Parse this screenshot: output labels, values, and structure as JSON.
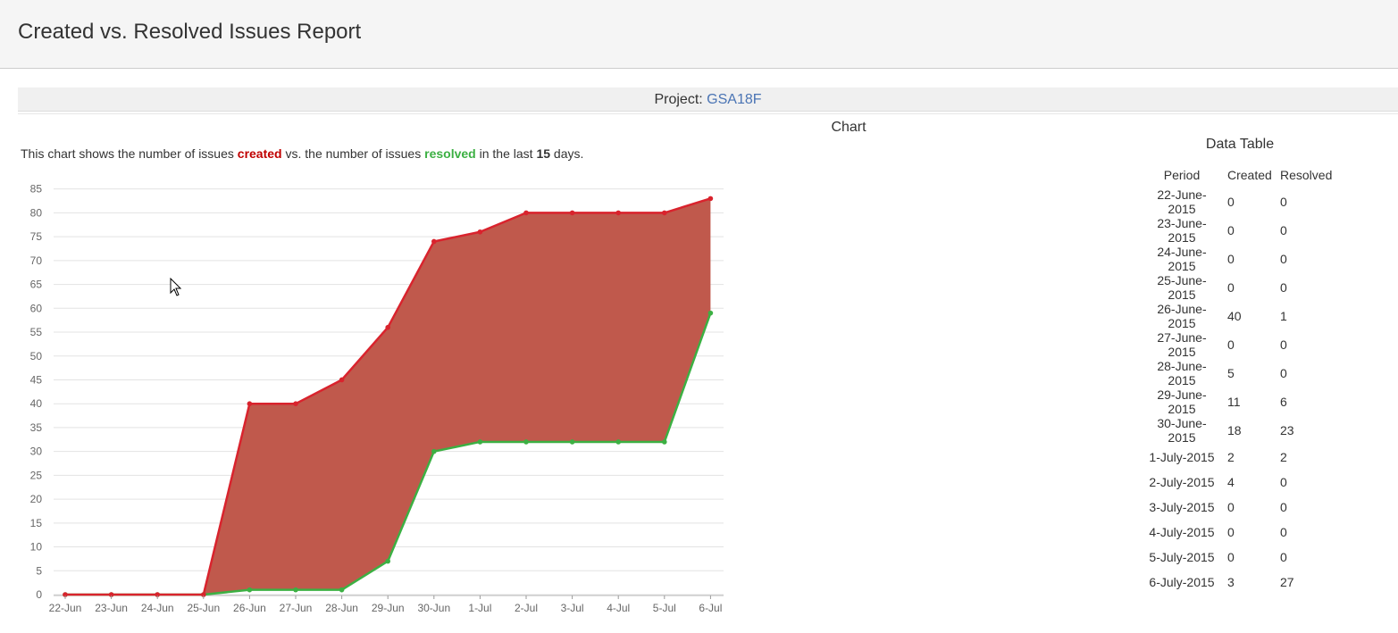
{
  "header": {
    "title": "Created vs. Resolved Issues Report"
  },
  "project": {
    "label": "Project:",
    "name": "GSA18F"
  },
  "chart_heading": "Chart",
  "description": {
    "prefix": "This chart shows the number of issues",
    "created_word": "created",
    "middle": "vs. the number of issues",
    "resolved_word": "resolved",
    "suffix_1": "in the last",
    "days": "15",
    "suffix_2": "days."
  },
  "colors": {
    "created": "#d9232d",
    "resolved": "#3cb043",
    "fill": "#c0594c",
    "link": "#4a74b4"
  },
  "chart_data": {
    "type": "area",
    "categories": [
      "22-Jun",
      "23-Jun",
      "24-Jun",
      "25-Jun",
      "26-Jun",
      "27-Jun",
      "28-Jun",
      "29-Jun",
      "30-Jun",
      "1-Jul",
      "2-Jul",
      "3-Jul",
      "4-Jul",
      "5-Jul",
      "6-Jul"
    ],
    "series": [
      {
        "values": [
          0,
          0,
          0,
          0,
          40,
          40,
          45,
          56,
          74,
          76,
          80,
          80,
          80,
          80,
          83
        ]
      },
      {
        "values": [
          0,
          0,
          0,
          0,
          1,
          1,
          1,
          7,
          30,
          32,
          32,
          32,
          32,
          32,
          59
        ]
      }
    ],
    "yticks": [
      0,
      5,
      10,
      15,
      20,
      25,
      30,
      35,
      40,
      45,
      50,
      55,
      60,
      65,
      70,
      75,
      80,
      85
    ],
    "ylim": [
      0,
      85
    ],
    "grid": true
  },
  "data_table": {
    "title": "Data Table",
    "headers": [
      "Period",
      "Created",
      "Resolved"
    ],
    "rows": [
      [
        "22-June-2015",
        "0",
        "0"
      ],
      [
        "23-June-2015",
        "0",
        "0"
      ],
      [
        "24-June-2015",
        "0",
        "0"
      ],
      [
        "25-June-2015",
        "0",
        "0"
      ],
      [
        "26-June-2015",
        "40",
        "1"
      ],
      [
        "27-June-2015",
        "0",
        "0"
      ],
      [
        "28-June-2015",
        "5",
        "0"
      ],
      [
        "29-June-2015",
        "11",
        "6"
      ],
      [
        "30-June-2015",
        "18",
        "23"
      ],
      [
        "1-July-2015",
        "2",
        "2"
      ],
      [
        "2-July-2015",
        "4",
        "0"
      ],
      [
        "3-July-2015",
        "0",
        "0"
      ],
      [
        "4-July-2015",
        "0",
        "0"
      ],
      [
        "5-July-2015",
        "0",
        "0"
      ],
      [
        "6-July-2015",
        "3",
        "27"
      ]
    ]
  }
}
